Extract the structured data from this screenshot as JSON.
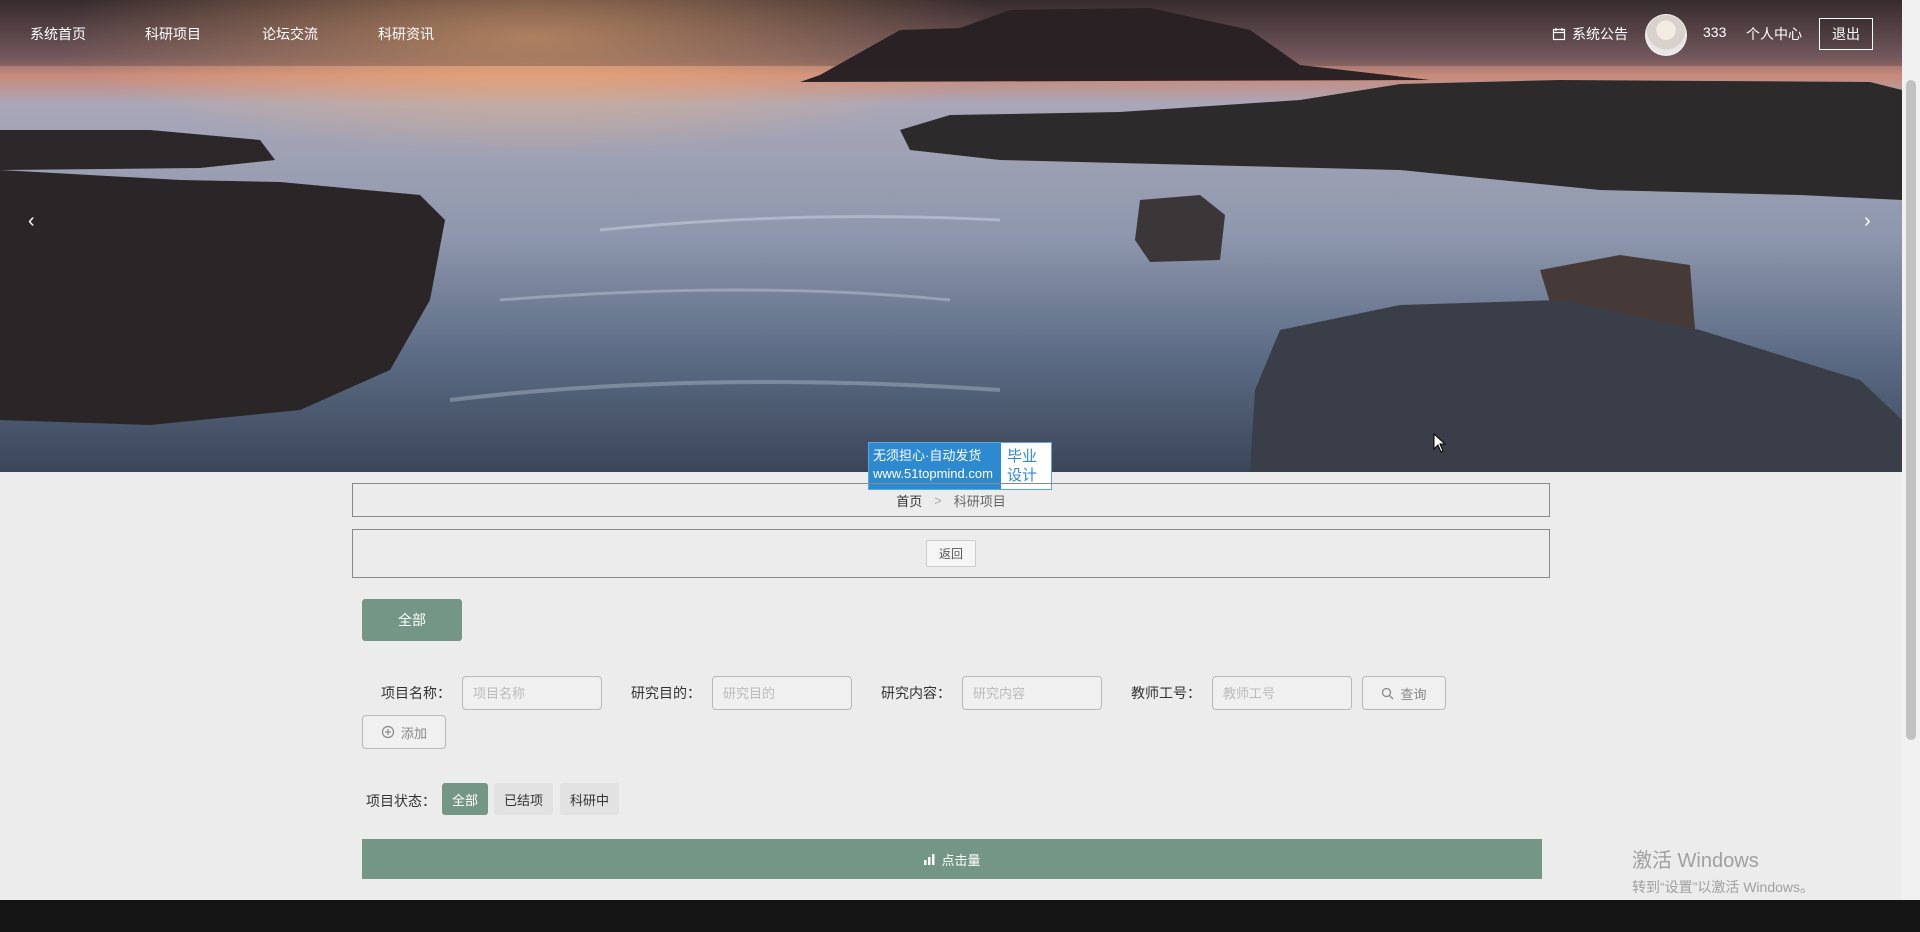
{
  "nav": {
    "items": [
      {
        "label": "系统首页"
      },
      {
        "label": "科研项目"
      },
      {
        "label": "论坛交流"
      },
      {
        "label": "科研资讯"
      }
    ],
    "notice_label": "系统公告",
    "username": "333",
    "center_label": "个人中心",
    "logout_label": "退出"
  },
  "carousel": {
    "prev_glyph": "‹",
    "next_glyph": "›"
  },
  "watermark": {
    "line1": "无须担心·自动发货",
    "line2": "www.51topmind.com",
    "right1": "毕业",
    "right2": "设计"
  },
  "breadcrumb": {
    "home": "首页",
    "separator": ">",
    "current": "科研项目"
  },
  "back_label": "返回",
  "category": {
    "all_label": "全部"
  },
  "filters": [
    {
      "label": "项目名称：",
      "placeholder": "项目名称"
    },
    {
      "label": "研究目的：",
      "placeholder": "研究目的"
    },
    {
      "label": "研究内容：",
      "placeholder": "研究内容"
    },
    {
      "label": "教师工号：",
      "placeholder": "教师工号"
    }
  ],
  "search_label": "查询",
  "add_label": "添加",
  "status": {
    "label": "项目状态：",
    "tabs": [
      {
        "label": "全部",
        "active": true
      },
      {
        "label": "已结项",
        "active": false
      },
      {
        "label": "科研中",
        "active": false
      }
    ]
  },
  "clicks_label": "点击量",
  "windows": {
    "line1": "激活 Windows",
    "line2": "转到“设置”以激活 Windows。"
  },
  "colors": {
    "accent": "#739687",
    "page_bg": "#ececec"
  },
  "icons": [
    "calendar-icon",
    "search-icon",
    "plus-circle-icon",
    "bar-chart-icon",
    "chevron-left-icon",
    "chevron-right-icon"
  ]
}
